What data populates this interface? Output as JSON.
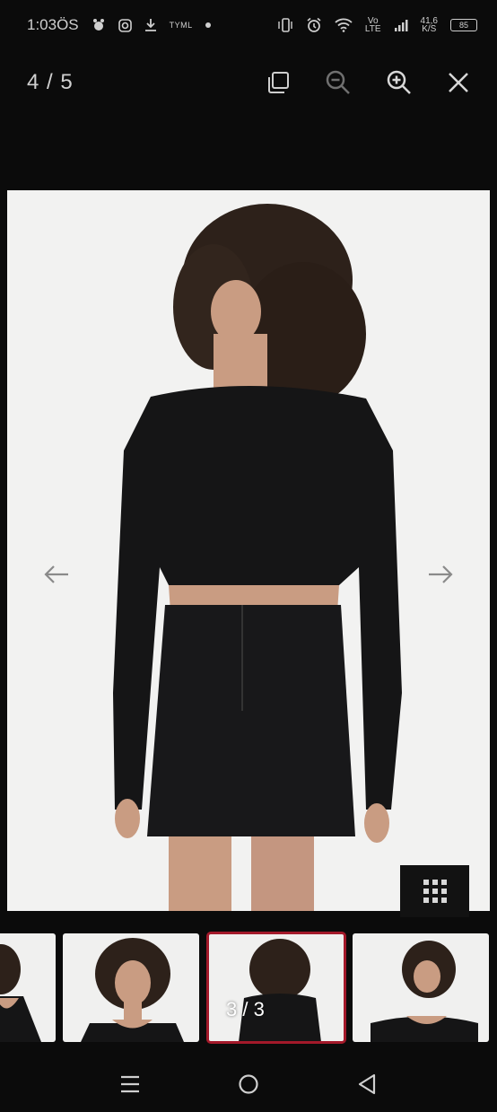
{
  "status_bar": {
    "time": "1:03ÖS",
    "small_label": "TYML",
    "net_top": "Vo",
    "net_bottom": "LTE",
    "speed_top": "41,6",
    "speed_bottom": "K/S",
    "battery": "85"
  },
  "viewer": {
    "counter": "4 / 5",
    "icons": [
      "copy-icon",
      "zoom-out-icon",
      "zoom-in-icon",
      "close-icon"
    ]
  },
  "gallery": {
    "prev_icon": "arrow-left-icon",
    "next_icon": "arrow-right-icon",
    "grid_icon": "grid-icon"
  },
  "thumbnails": {
    "selected_label": "3 / 3"
  },
  "colors": {
    "background": "#0b0b0b",
    "image_bg": "#f2f2f1",
    "selected_outline": "#a3192a"
  },
  "nav": {
    "icons": [
      "recents-icon",
      "home-icon",
      "back-icon"
    ]
  }
}
